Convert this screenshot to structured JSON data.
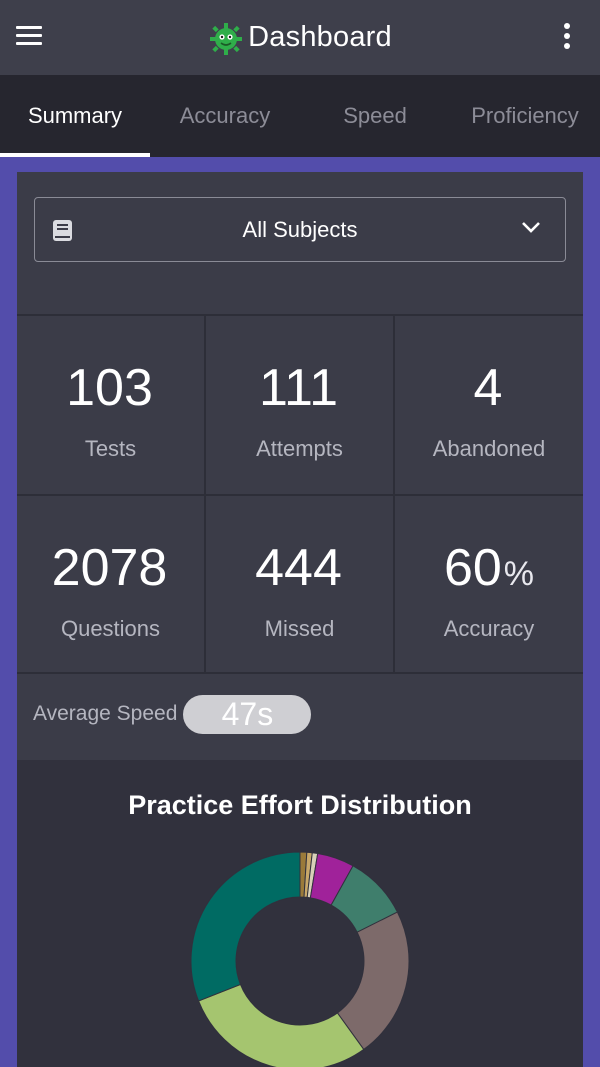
{
  "appbar": {
    "title": "Dashboard",
    "menu_icon": "hamburger-menu-icon",
    "more_icon": "vertical-dots-icon",
    "logo_icon": "green-gear-mascot-icon"
  },
  "tabs": [
    {
      "label": "Summary",
      "active": true
    },
    {
      "label": "Accuracy",
      "active": false
    },
    {
      "label": "Speed",
      "active": false
    },
    {
      "label": "Proficiency",
      "active": false
    }
  ],
  "subject_select": {
    "value": "All Subjects",
    "icon": "book-icon",
    "chevron": "chevron-down-icon"
  },
  "stats": [
    {
      "value": "103",
      "unit": "",
      "label": "Tests"
    },
    {
      "value": "111",
      "unit": "",
      "label": "Attempts"
    },
    {
      "value": "4",
      "unit": "",
      "label": "Abandoned"
    },
    {
      "value": "2078",
      "unit": "",
      "label": "Questions"
    },
    {
      "value": "444",
      "unit": "",
      "label": "Missed"
    },
    {
      "value": "60",
      "unit": "%",
      "label": "Accuracy"
    }
  ],
  "average_speed": {
    "label": "Average Speed",
    "value": "47s"
  },
  "chart_data": {
    "type": "pie",
    "title": "Practice Effort Distribution",
    "values": [
      1.0,
      0.8,
      0.8,
      5.5,
      9.5,
      22.5,
      29.0,
      31.0
    ],
    "colors": [
      "#9a7a3a",
      "#c8a86a",
      "#d8d0b8",
      "#a0229a",
      "#3f7e6c",
      "#7d6a6a",
      "#a5c56f",
      "#006b63"
    ]
  },
  "colors": {
    "frame": "#534dab",
    "appbar": "#3e3f4b",
    "tabbar": "#26262f",
    "card": "#3b3c48",
    "chart_panel": "#31313d"
  }
}
